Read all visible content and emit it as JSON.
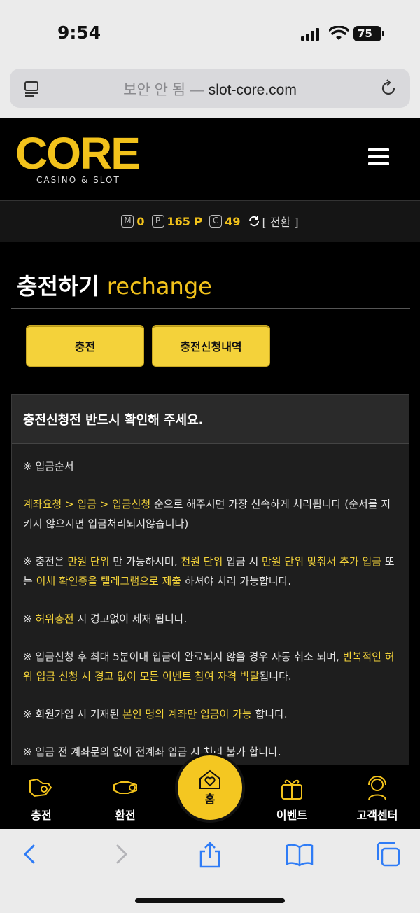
{
  "status": {
    "time": "9:54",
    "battery": "75"
  },
  "browser": {
    "url_prefix": "보안 안 됨 —",
    "url_domain": "slot-core.com"
  },
  "site": {
    "logo_text": "CORE",
    "logo_sub": "CASINO & SLOT"
  },
  "points": {
    "m_badge": "M",
    "m_value": "0",
    "p_badge": "P",
    "p_value": "165 P",
    "c_badge": "C",
    "c_value": "49",
    "switch_label": "[ 전환 ]"
  },
  "page": {
    "title_ko": "충전하기",
    "title_en": "rechange"
  },
  "buttons": {
    "charge": "충전",
    "history": "충전신청내역"
  },
  "notice": {
    "header": "충전신청전 반드시 확인해 주세요.",
    "order_title": "※ 입금순서",
    "p1_y": "계좌요청 > 입금 > 입금신청",
    "p1_rest": " 순으로 해주시면 가장 신속하게 처리됩니다 (순서를 지키지 않으시면 입금처리되지않습니다)",
    "p2_a": "※ 충전은 ",
    "p2_y1": "만원 단위",
    "p2_b": " 만 가능하시며, ",
    "p2_y2": "천원 단위",
    "p2_c": " 입금 시 ",
    "p2_y3": "만원 단위 맞춰서 추가 입금",
    "p2_d": " 또는 ",
    "p2_y4": "이체 확인증을 텔레그램으로 제출",
    "p2_e": " 하셔야 처리 가능합니다.",
    "p3_a": "※ ",
    "p3_y": "허위충전",
    "p3_b": " 시 경고없이 제재 됩니다.",
    "p4_a": "※ 입금신청 후 최대 5분이내 입금이 완료되지 않을 경우 자동 취소 되며, ",
    "p4_y": "반복적인 허위 입금 신청 시 경고 없이 모든 이벤트 참여 자격 박탈",
    "p4_b": "됩니다.",
    "p5_a": "※ 회원가입 시 기재된 ",
    "p5_y": "본인 명의 계좌만 입금이 가능",
    "p5_b": " 합니다.",
    "p6": "※ 입금 전 계좌문의 없이 전계좌 입금 시 처리 불가 합니다."
  },
  "nav": {
    "charge": "충전",
    "exchange": "환전",
    "home": "홈",
    "event": "이벤트",
    "support": "고객센터"
  },
  "colors": {
    "accent": "#f2c21b",
    "button": "#f4d23a",
    "highlight": "#f2d23a"
  }
}
